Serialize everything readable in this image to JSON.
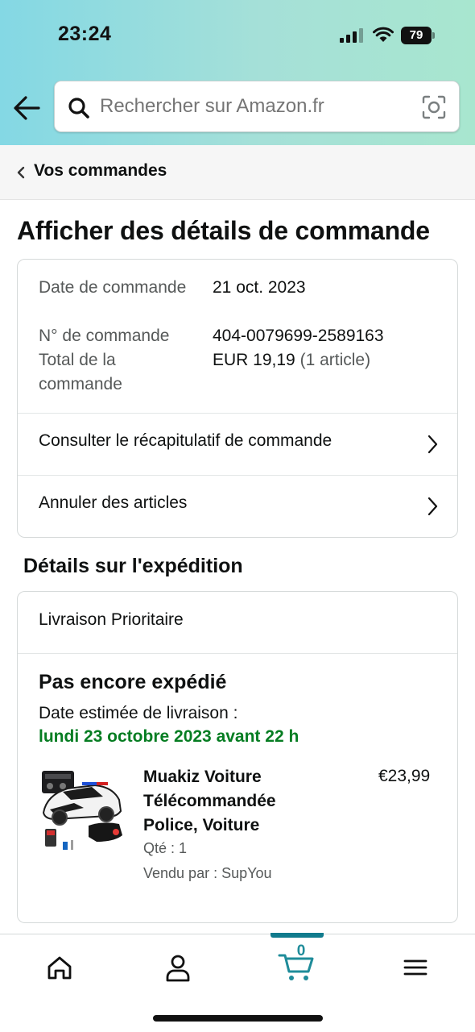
{
  "status_bar": {
    "time": "23:24",
    "battery": "79"
  },
  "search": {
    "placeholder": "Rechercher sur Amazon.fr"
  },
  "breadcrumb": {
    "label": "Vos commandes"
  },
  "page_title": "Afficher des détails de commande",
  "order_summary": {
    "date_label": "Date de commande",
    "date_value": "21 oct. 2023",
    "number_label": "N° de commande",
    "number_value": "404-0079699-2589163",
    "total_label": "Total de la commande",
    "total_value": "EUR 19,19",
    "total_count": "(1 article)",
    "links": [
      {
        "label": "Consulter le récapitulatif de commande"
      },
      {
        "label": "Annuler des articles"
      }
    ]
  },
  "shipping": {
    "section_title": "Détails sur l'expédition",
    "method": "Livraison Prioritaire",
    "status": "Pas encore expédié",
    "delivery_label": "Date estimée de livraison :",
    "delivery_date": "lundi 23 octobre 2023 avant 22 h",
    "delivery_color": "#067d22",
    "product": {
      "title": "Muakiz Voiture Télécommandée Police, Voiture",
      "price": "€23,99",
      "quantity": "Qté : 1",
      "seller": "Vendu par : SupYou"
    }
  },
  "bottom_nav": {
    "cart_count": "0",
    "items": [
      {
        "icon": "home-icon"
      },
      {
        "icon": "account-icon"
      },
      {
        "icon": "cart-icon"
      },
      {
        "icon": "menu-icon"
      }
    ]
  },
  "colors": {
    "accent": "#117b8d",
    "header_start": "#84d8e4",
    "header_end": "#a8e6cf"
  }
}
